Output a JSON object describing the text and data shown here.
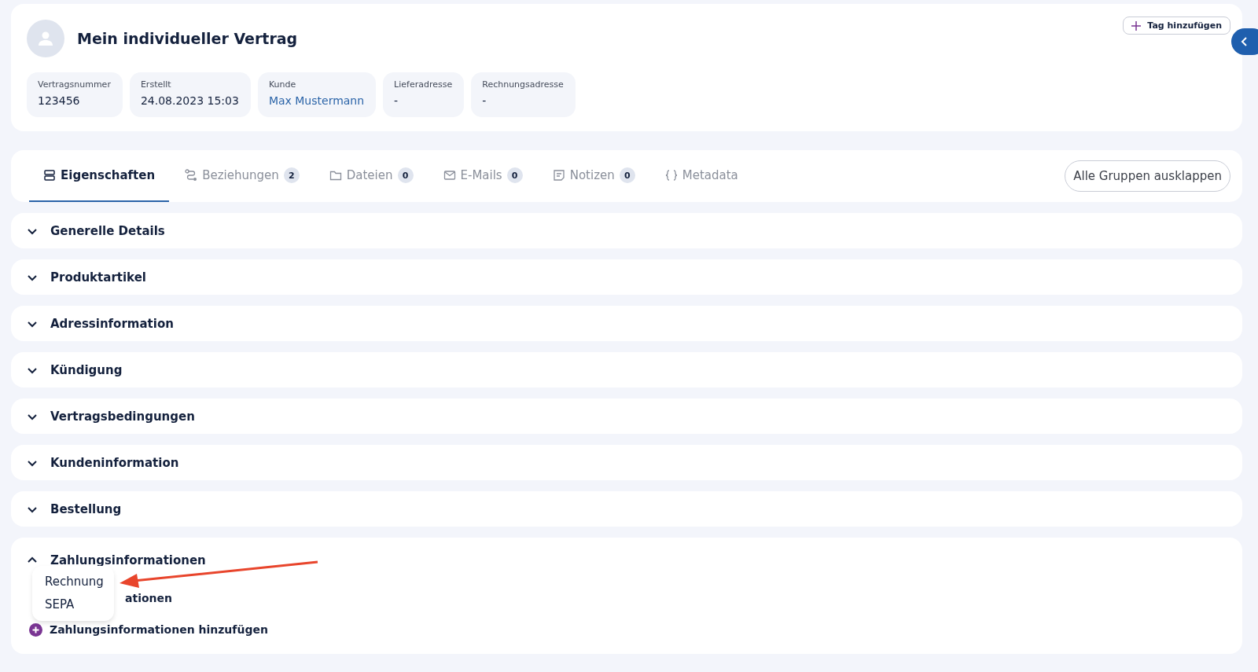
{
  "header": {
    "title": "Mein individueller Vertrag",
    "tag_button": "Tag hinzufügen",
    "fields": [
      {
        "label": "Vertragsnummer",
        "value": "123456",
        "kind": "text"
      },
      {
        "label": "Erstellt",
        "value": "24.08.2023 15:03",
        "kind": "text"
      },
      {
        "label": "Kunde",
        "value": "Max Mustermann",
        "kind": "link"
      },
      {
        "label": "Lieferadresse",
        "value": "-",
        "kind": "text"
      },
      {
        "label": "Rechnungsadresse",
        "value": "-",
        "kind": "text"
      }
    ]
  },
  "tabs": [
    {
      "label": "Eigenschaften",
      "selected": true
    },
    {
      "label": "Beziehungen",
      "count": "2",
      "selected": false
    },
    {
      "label": "Dateien",
      "count": "0",
      "selected": false
    },
    {
      "label": "E-Mails",
      "count": "0",
      "selected": false
    },
    {
      "label": "Notizen",
      "count": "0",
      "selected": false
    },
    {
      "label": "Metadata",
      "selected": false
    }
  ],
  "expand_all_button": "Alle Gruppen ausklappen",
  "groups": [
    {
      "title": "Generelle Details",
      "expanded": false
    },
    {
      "title": "Produktartikel",
      "expanded": false
    },
    {
      "title": "Adressinformation",
      "expanded": false
    },
    {
      "title": "Kündigung",
      "expanded": false
    },
    {
      "title": "Vertragsbedingungen",
      "expanded": false
    },
    {
      "title": "Kundeninformation",
      "expanded": false
    },
    {
      "title": "Bestellung",
      "expanded": false
    },
    {
      "title": "Zahlungsinformationen",
      "expanded": true,
      "subtitle": "ationen",
      "add_label": "Zahlungsinformationen hinzufügen",
      "menu": [
        "Rechnung",
        "SEPA"
      ]
    }
  ]
}
